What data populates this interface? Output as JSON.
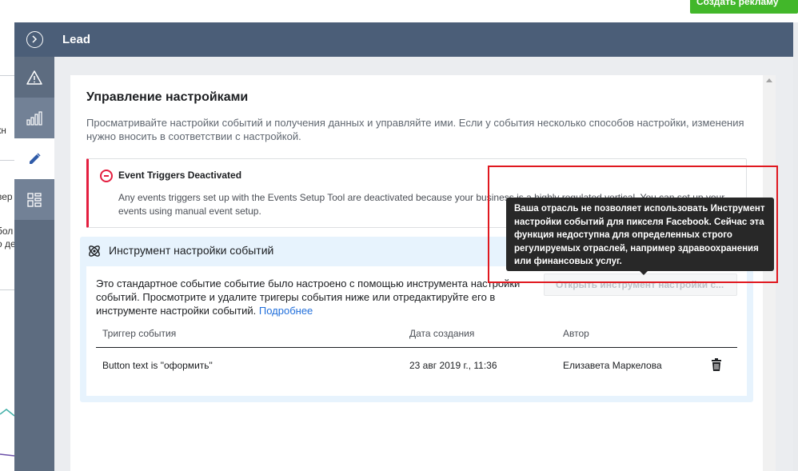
{
  "topbar": {
    "create_ad_label": "Создать рекламу"
  },
  "background_page": {
    "fragments": [
      "кн",
      "вер",
      "бол",
      "о де"
    ]
  },
  "panel": {
    "title": "Lead"
  },
  "rail": {
    "items": [
      {
        "icon": "warning-icon",
        "active": false
      },
      {
        "icon": "bar-chart-icon",
        "active": false
      },
      {
        "icon": "pencil-icon",
        "active": true
      },
      {
        "icon": "grid-icon",
        "active": false
      }
    ]
  },
  "card": {
    "title": "Управление настройками",
    "description": "Просматривайте настройки событий и получения данных и управляйте ими. Если у события несколько способов настройки, изменения нужно вносить в соответствии с настройкой."
  },
  "alert": {
    "title": "Event Triggers Deactivated",
    "text": "Any events triggers set up with the Events Setup Tool are deactivated because your business is a highly regulated vertical. You can set up your events using manual event setup."
  },
  "toolbox": {
    "title": "Инструмент настройки событий",
    "description": "Это стандартное событие событие было настроено с помощью инструмента настройки событий. Просмотрите и удалите тригеры события ниже или отредактируйте его в инструменте настройки событий.",
    "learn_more": "Подробнее",
    "open_button": "Открыть инструмент настройки с...",
    "table": {
      "headers": [
        "Триггер события",
        "Дата создания",
        "Автор"
      ],
      "rows": [
        {
          "trigger": "Button text is \"оформить\"",
          "date": "23 авг 2019 г., 11:36",
          "author": "Елизавета Маркелова"
        }
      ]
    }
  },
  "tooltip": {
    "text": "Ваша отрасль не позволяет использовать Инструмент настройки событий для пикселя Facebook. Сейчас эта функция недоступна для определенных строго регулируемых отраслей, например здравоохранения или финансовых услуг."
  },
  "colors": {
    "header": "#4b5e78",
    "rail": "#5d6c80",
    "alert_red": "#e41e3f",
    "link_blue": "#216fdb",
    "cta_green": "#42b72a",
    "highlight_red": "#e0181f"
  }
}
